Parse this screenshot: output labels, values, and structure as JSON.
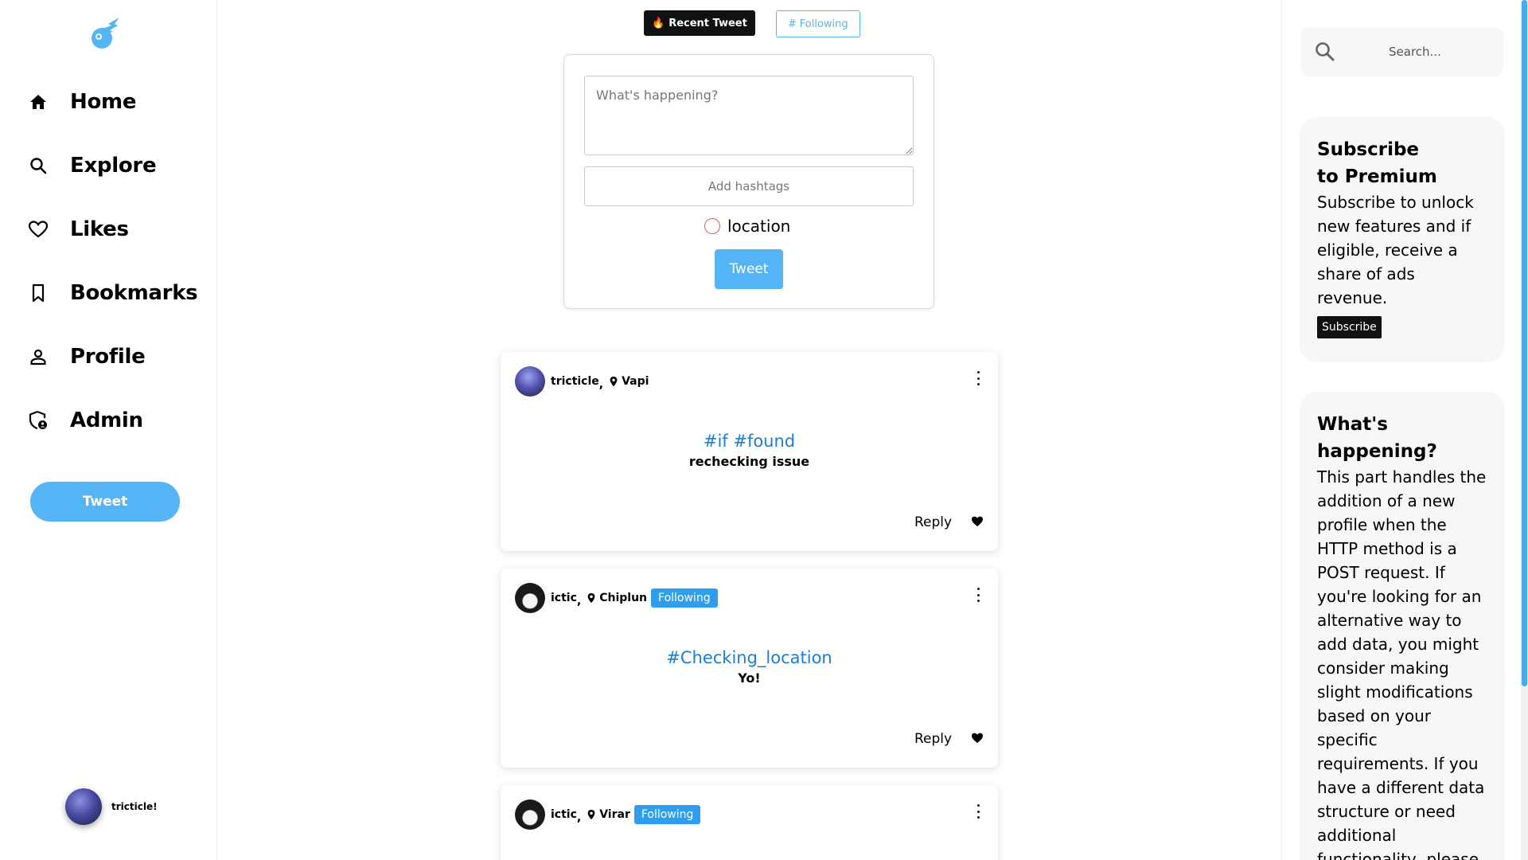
{
  "nav": {
    "items": [
      {
        "label": "Home",
        "icon": "home-icon"
      },
      {
        "label": "Explore",
        "icon": "search-icon"
      },
      {
        "label": "Likes",
        "icon": "heart-icon"
      },
      {
        "label": "Bookmarks",
        "icon": "bookmark-icon"
      },
      {
        "label": "Profile",
        "icon": "user-icon"
      },
      {
        "label": "Admin",
        "icon": "admin-shield-icon"
      }
    ],
    "tweet_label": "Tweet",
    "current_user": "tricticle!"
  },
  "tabs": {
    "recent_label": "Recent Tweet",
    "following_label": "Following"
  },
  "composer": {
    "text_placeholder": "What's happening?",
    "hashtags_placeholder": "Add hashtags",
    "location_label": "location",
    "tweet_label": "Tweet"
  },
  "posts": [
    {
      "user": "tricticle",
      "location": "Vapi",
      "following": "",
      "hashtags": "#if #found",
      "text": "rechecking issue",
      "reply_label": "Reply"
    },
    {
      "user": "ictic",
      "location": "Chiplun",
      "following": "Following",
      "hashtags": "#Checking_location",
      "text": "Yo!",
      "reply_label": "Reply"
    },
    {
      "user": "ictic",
      "location": "Virar",
      "following": "Following"
    }
  ],
  "search": {
    "placeholder": "Search..."
  },
  "premium": {
    "title_line1": "Subscribe",
    "title_line2": "to Premium",
    "body": "Subscribe to unlock new features and if eligible, receive a share of ads revenue.",
    "button": "Subscribe"
  },
  "happening": {
    "title": "What's happening?",
    "body": "This part handles the addition of a new profile when the HTTP method is a POST request. If you're looking for an alternative way to add data, you might consider making slight modifications based on your specific requirements. If you have a different data structure or need additional functionality, please"
  },
  "colors": {
    "accent": "#55b4f5",
    "tag_blue": "#1d7cd6",
    "badge_blue": "#2f9ef0",
    "dark": "#111111"
  }
}
